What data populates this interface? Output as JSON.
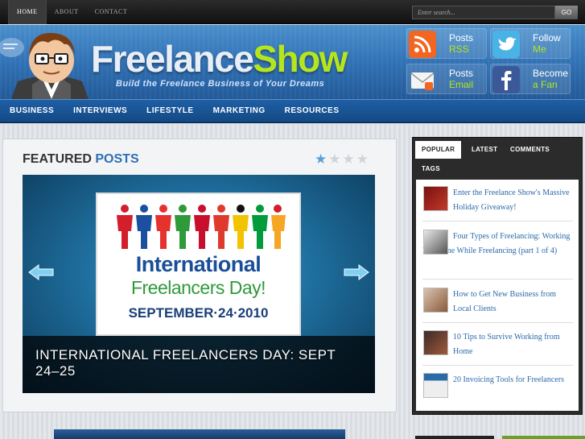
{
  "topnav": {
    "items": [
      {
        "label": "HOME",
        "active": true
      },
      {
        "label": "ABOUT",
        "active": false
      },
      {
        "label": "CONTACT",
        "active": false
      }
    ]
  },
  "search": {
    "placeholder": "Enter search...",
    "button": "GO"
  },
  "header": {
    "logo_part1": "Freelance",
    "logo_part2": "Show",
    "tagline": "Build the Freelance Business of Your Dreams",
    "colors": {
      "brand_blue": "#2f6fb3",
      "brand_green": "#b5e61d"
    },
    "social": [
      {
        "line1": "Posts",
        "line2": "RSS",
        "icon": "rss-icon"
      },
      {
        "line1": "Follow",
        "line2": "Me",
        "icon": "twitter-bird-icon"
      },
      {
        "line1": "Posts",
        "line2": "Email",
        "icon": "email-icon"
      },
      {
        "line1": "Become",
        "line2": "a Fan",
        "icon": "facebook-icon"
      }
    ]
  },
  "mainnav": {
    "items": [
      "BUSINESS",
      "INTERVIEWS",
      "LIFESTYLE",
      "MARKETING",
      "RESOURCES"
    ]
  },
  "featured": {
    "title_part1": "FEATURED",
    "title_part2": "POSTS",
    "slide_count": 4,
    "active_slide": 1,
    "slide": {
      "poster_line1": "International",
      "poster_line2": "Freelancers Day!",
      "poster_line3": "SEPTEMBER·24·2010",
      "caption": "INTERNATIONAL FREELANCERS DAY: SEPT 24–25"
    }
  },
  "sidebar": {
    "tabs": [
      {
        "label": "POPULAR",
        "active": true
      },
      {
        "label": "LATEST",
        "active": false
      },
      {
        "label": "COMMENTS",
        "active": false
      },
      {
        "label": "TAGS",
        "active": false
      }
    ],
    "items": [
      {
        "title": "Enter the Freelance Show's Massive Holiday Giveaway!"
      },
      {
        "title": "Four Types of Freelancing: Working Full-Time While Freelancing (part 1 of 4)"
      },
      {
        "title": "How to Get New Business from Local Clients"
      },
      {
        "title": "10 Tips to Survive Working from Home"
      },
      {
        "title": "20 Invoicing Tools for Freelancers"
      }
    ]
  }
}
